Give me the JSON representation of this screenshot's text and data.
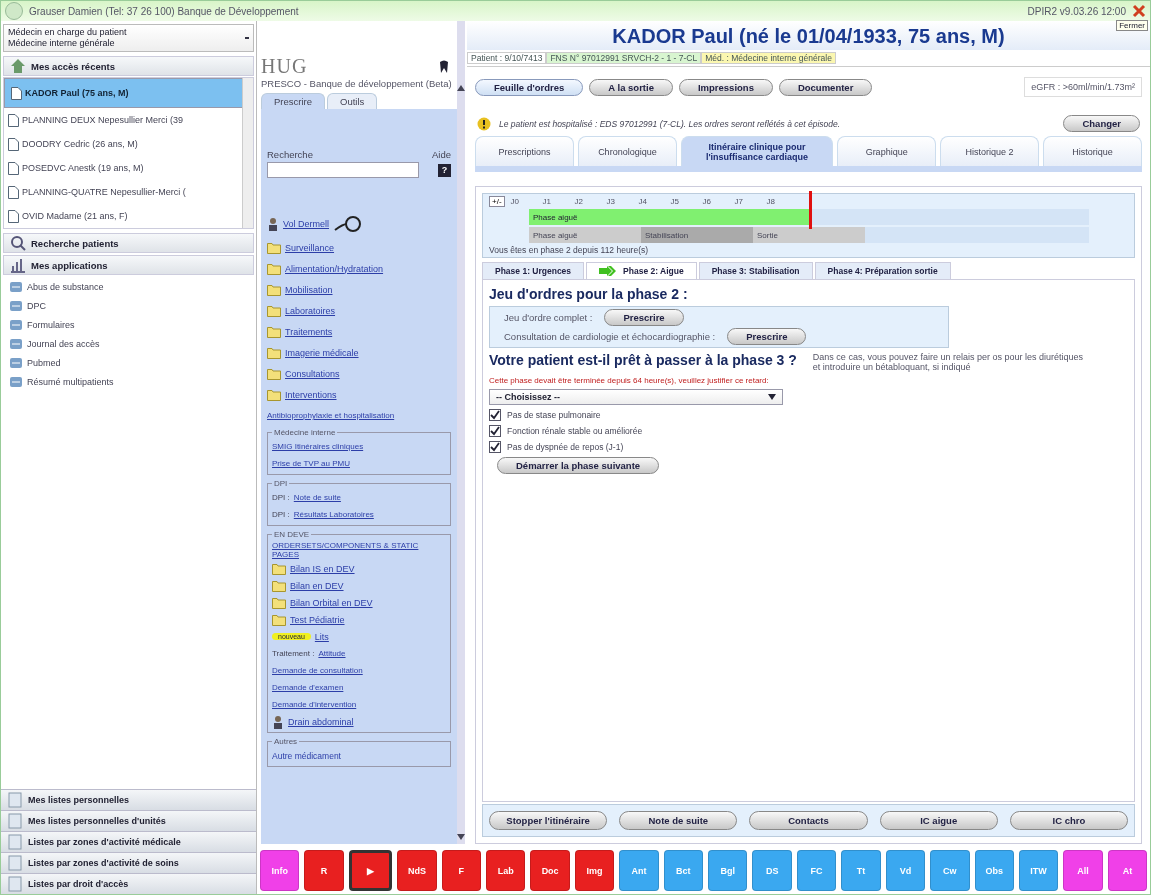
{
  "header": {
    "user": "Grauser Damien (Tel: 37 26 100) Banque de Développement",
    "version": "DPIR2 v9.03.26 12:00",
    "close_tip": "Fermer"
  },
  "sidebar": {
    "role_select": [
      "Médecin en charge du patient",
      "Médecine interne générale"
    ],
    "recent": {
      "title": "Mes accès récents",
      "patients": [
        {
          "name": "KADOR Paul (75 ans, M)",
          "selected": true
        },
        {
          "name": "PLANNING DEUX Nepesullier Merci (39",
          "selected": false
        },
        {
          "name": "DOODRY Cedric (26 ans, M)",
          "selected": false
        },
        {
          "name": "POSEDVC Anestk (19 ans, M)",
          "selected": false
        },
        {
          "name": "PLANNING-QUATRE Nepesullier-Merci (",
          "selected": false
        },
        {
          "name": "OVID Madame (21 ans, F)",
          "selected": false
        }
      ]
    },
    "search_title": "Recherche patients",
    "apps_title": "Mes applications",
    "apps": [
      "Abus de substance",
      "DPC",
      "Formulaires",
      "Journal des accès",
      "Pubmed",
      "Résumé multipatients"
    ],
    "bottom": [
      "Mes listes personnelles",
      "Mes listes personnelles d'unités",
      "Listes par zones d'activité médicale",
      "Listes par zones d'activité de soins",
      "Listes par droit d'accès"
    ]
  },
  "presco": {
    "logo": "HUG",
    "subtitle": "PRESCO - Banque de développement (Beta)",
    "tabs": [
      {
        "label": "Prescrire",
        "selected": true
      },
      {
        "label": "Outils",
        "selected": false
      }
    ],
    "search_label": "Recherche",
    "help_label": "Aide",
    "help_key": "?",
    "top_link": "Vol Dermell",
    "folders": [
      "Surveillance",
      "Alimentation/Hydratation",
      "Mobilisation",
      "Laboratoires",
      "Traitements",
      "Imagerie médicale",
      "Consultations",
      "Interventions"
    ],
    "plain_link": "Antibioprophylaxie et hospitalisation",
    "groups": [
      {
        "title": "Médecine interne",
        "items": [
          {
            "kind": "link",
            "text": "SMIG Itinéraires cliniques"
          },
          {
            "kind": "link",
            "text": "Prise de TVP au PMU"
          }
        ]
      },
      {
        "title": "DPI",
        "items": [
          {
            "kind": "prefixed",
            "prefix": "DPI :",
            "text": "Note de suite"
          },
          {
            "kind": "prefixed",
            "prefix": "DPI :",
            "text": "Résultats Laboratoires"
          }
        ]
      },
      {
        "title": "EN DEVE",
        "items": [
          {
            "kind": "link",
            "text": "ORDERSETS/COMPONENTS & STATIC PAGES"
          },
          {
            "kind": "folder",
            "text": "Bilan IS en DEV"
          },
          {
            "kind": "folder",
            "text": "Bilan en DEV"
          },
          {
            "kind": "folder",
            "text": "Bilan Orbital en DEV"
          },
          {
            "kind": "folder",
            "text": "Test Pédiatrie"
          },
          {
            "kind": "tagged",
            "tag": "nouveau",
            "text": "Lits"
          },
          {
            "kind": "prefixed",
            "prefix": "Traitement :",
            "text": "Attitude"
          },
          {
            "kind": "link",
            "text": "Demande de consultation"
          },
          {
            "kind": "link",
            "text": "Demande d'examen"
          },
          {
            "kind": "link",
            "text": "Demande d'intervention"
          },
          {
            "kind": "person",
            "text": "Drain abdominal"
          }
        ]
      },
      {
        "title": "Autres",
        "items": [
          {
            "kind": "plain",
            "text": "Autre médicament"
          }
        ]
      }
    ]
  },
  "patient": {
    "title": "KADOR Paul (né le 01/04/1933, 75 ans, M)",
    "badges": [
      {
        "text": "Patient : 9/10/7413",
        "color": "#ffffff"
      },
      {
        "text": "FNS N° 97012991 SRVCH-2 - 1 - 7-CL",
        "color": "#d8f5d0"
      },
      {
        "text": "Méd. : Médecine interne générale",
        "color": "#fbf7b0"
      }
    ],
    "actions": [
      {
        "label": "Feuille d'ordres",
        "selected": true
      },
      {
        "label": "A la sortie",
        "selected": false
      },
      {
        "label": "Impressions",
        "selected": false
      },
      {
        "label": "Documenter",
        "selected": false
      }
    ],
    "egfr": "eGFR : >60ml/min/1.73m²",
    "notice": "Le patient est hospitalisé : EDS 97012991 (7-CL). Les ordres seront reflétés à cet épisode.",
    "change_button": "Changer",
    "tabs": [
      {
        "label": "Prescriptions",
        "selected": false
      },
      {
        "label": "Chronologique",
        "selected": false
      },
      {
        "label": "Itinéraire clinique pour l'insuffisance cardiaque",
        "selected": true
      },
      {
        "label": "Graphique",
        "selected": false
      },
      {
        "label": "Historique 2",
        "selected": false
      },
      {
        "label": "Historique",
        "selected": false
      }
    ]
  },
  "timeline": {
    "toggle": "+/-",
    "days": [
      "J0",
      "J1",
      "J2",
      "J3",
      "J4",
      "J5",
      "J6",
      "J7",
      "J8"
    ],
    "current": {
      "label": "Phase aiguë",
      "level": 0.5
    },
    "plan": [
      {
        "label": "Phase aiguë"
      },
      {
        "label": "Stabilisation"
      },
      {
        "label": "Sortie"
      }
    ],
    "status": "Vous êtes en phase 2 depuis 112 heure(s)"
  },
  "phases": [
    {
      "label": "Phase 1: Urgences",
      "selected": false,
      "current": false
    },
    {
      "label": "Phase 2: Aigue",
      "selected": true,
      "current": true
    },
    {
      "label": "Phase 3: Stabilisation",
      "selected": false,
      "current": false
    },
    {
      "label": "Phase 4: Préparation sortie",
      "selected": false,
      "current": false
    }
  ],
  "phase_body": {
    "orders_title": "Jeu d'ordres pour la phase 2 :",
    "orders": [
      {
        "label": "Jeu d'ordre complet :",
        "button": "Prescrire"
      },
      {
        "label": "Consultation de cardiologie et échocardiographie :",
        "button": "Prescrire"
      }
    ],
    "question": "Votre patient est-il prêt à passer à la phase 3 ?",
    "hint": "Dans ce cas, vous pouvez faire un relais per os pour les diurétiques et introduire un bétabloquant, si indiqué",
    "warning": "Cette phase devait être terminée depuis 64 heure(s), veuillez justifier ce retard:",
    "reason_select": "-- Choisissez --",
    "criteria": [
      {
        "label": "Pas de stase pulmonaire",
        "checked": true
      },
      {
        "label": "Fonction rénale stable ou améliorée",
        "checked": true
      },
      {
        "label": "Pas de dyspnée de repos (J-1)",
        "checked": true
      }
    ],
    "next_button": "Démarrer la phase suivante"
  },
  "footer_buttons": [
    "Stopper l'itinéraire",
    "Note de suite",
    "Contacts",
    "IC aigue",
    "IC chro"
  ],
  "toolbar": [
    {
      "label": "Info",
      "color": "#f040e8",
      "selected": false
    },
    {
      "label": "R",
      "color": "#e82020",
      "selected": false
    },
    {
      "label": "▶",
      "color": "#e82020",
      "selected": true
    },
    {
      "label": "NdS",
      "color": "#e82020",
      "selected": false
    },
    {
      "label": "F",
      "color": "#e82020",
      "selected": false
    },
    {
      "label": "Lab",
      "color": "#e82020",
      "selected": false
    },
    {
      "label": "Doc",
      "color": "#e82020",
      "selected": false
    },
    {
      "label": "Img",
      "color": "#e82020",
      "selected": false
    },
    {
      "label": "Ant",
      "color": "#3aa8f0",
      "selected": false
    },
    {
      "label": "Bct",
      "color": "#3aa8f0",
      "selected": false
    },
    {
      "label": "Bgl",
      "color": "#3aa8f0",
      "selected": false
    },
    {
      "label": "DS",
      "color": "#3aa8f0",
      "selected": false
    },
    {
      "label": "FC",
      "color": "#3aa8f0",
      "selected": false
    },
    {
      "label": "Tt",
      "color": "#3aa8f0",
      "selected": false
    },
    {
      "label": "Vd",
      "color": "#3aa8f0",
      "selected": false
    },
    {
      "label": "Cw",
      "color": "#3aa8f0",
      "selected": false
    },
    {
      "label": "Obs",
      "color": "#3aa8f0",
      "selected": false
    },
    {
      "label": "ITW",
      "color": "#3aa8f0",
      "selected": false
    },
    {
      "label": "All",
      "color": "#f040e8",
      "selected": false
    },
    {
      "label": "At",
      "color": "#f040e8",
      "selected": false
    }
  ]
}
